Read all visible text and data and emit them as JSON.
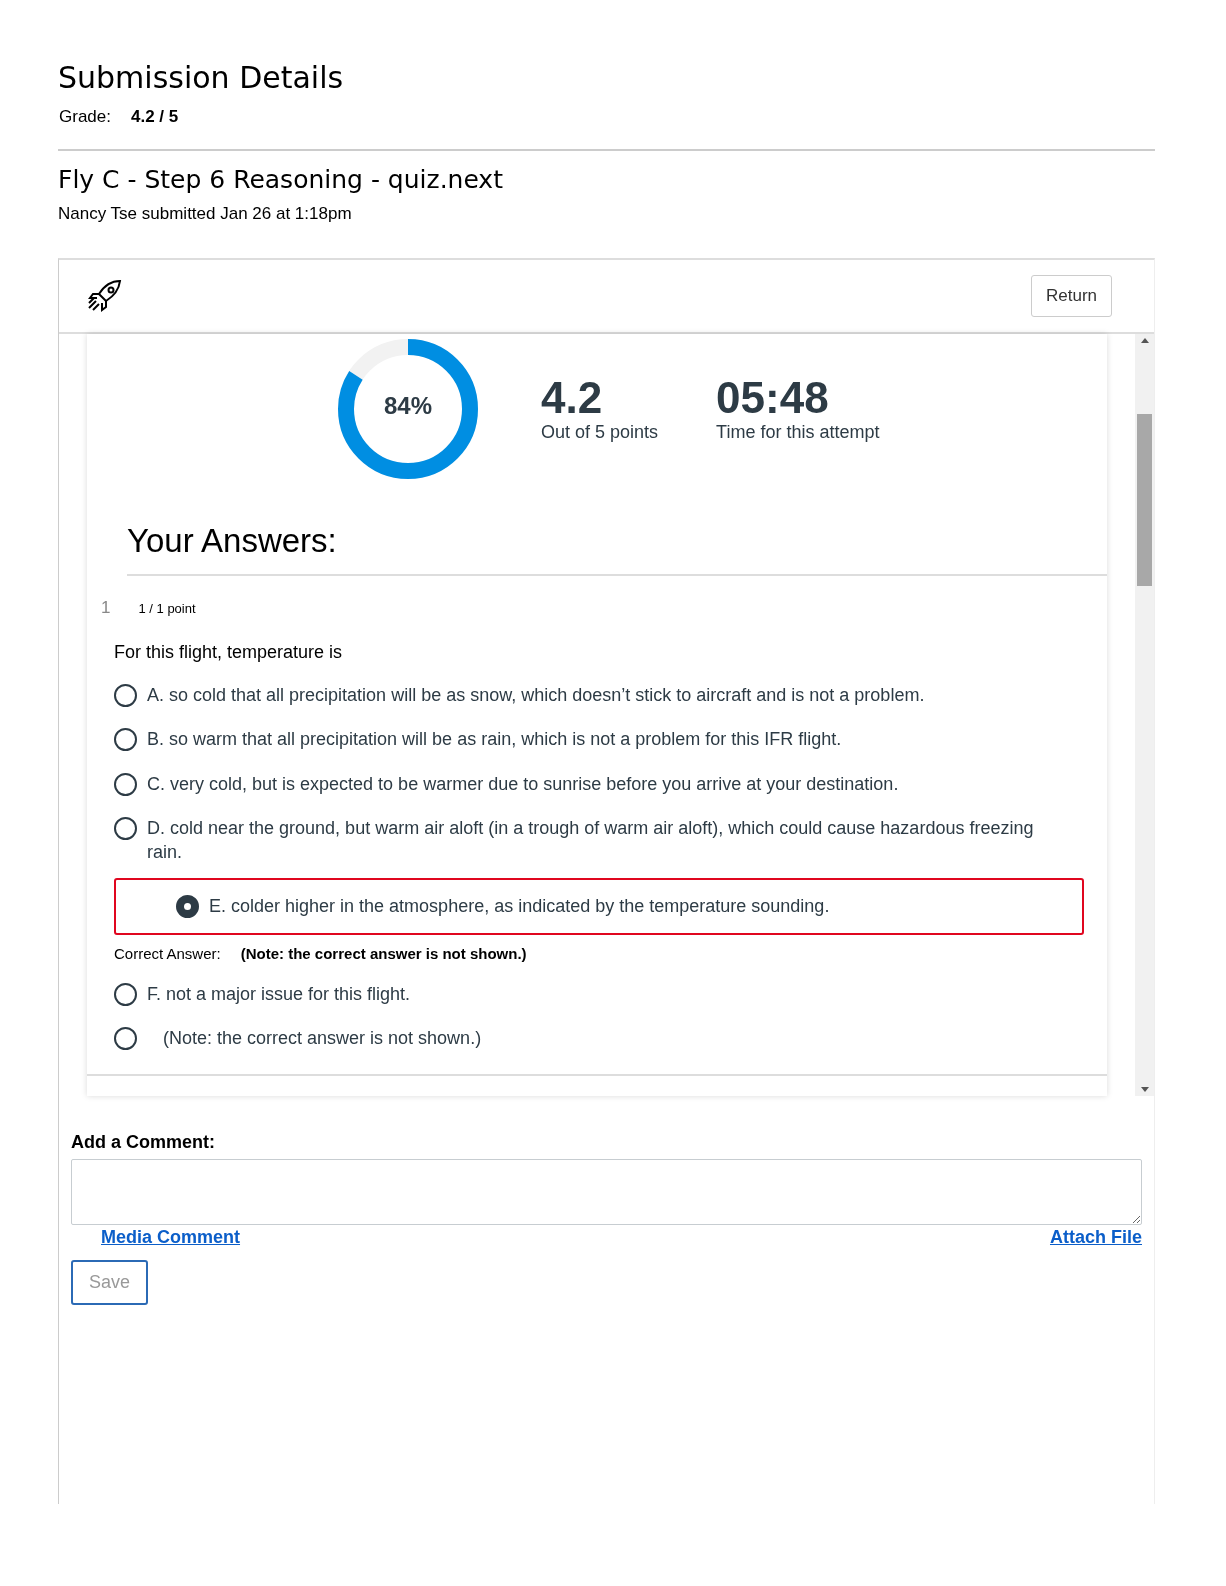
{
  "page_title": "Submission Details",
  "grade": {
    "label": "Grade:",
    "value": "4.2 / 5"
  },
  "assignment": {
    "title": "Fly C - Step 6 Reasoning - quiz.next",
    "submitted": "Nancy Tse submitted Jan 26 at 1:18pm"
  },
  "quiz": {
    "return_button": "Return",
    "score": {
      "percent": "84%"
    },
    "points": {
      "value": "4.2",
      "label": "Out of 5 points"
    },
    "time": {
      "value": "05:48",
      "label": "Time for this attempt"
    },
    "answers_heading": "Your Answers:",
    "questions": [
      {
        "number": "1",
        "points": "1 / 1 point",
        "prompt": "For this flight, temperature is",
        "options": [
          {
            "kind": "option",
            "text": "A. so cold that all precipitation will be as snow, which doesn’t stick to aircraft and is not a problem.",
            "selected": false
          },
          {
            "kind": "option",
            "text": "B. so warm that all precipitation will be as rain, which is not a problem for this IFR flight.",
            "selected": false
          },
          {
            "kind": "option",
            "text": "C. very cold, but is expected to be warmer due to sunrise before you arrive at your destination.",
            "selected": false
          },
          {
            "kind": "option",
            "text": "D. cold near the ground, but warm air aloft (in a trough of warm air aloft), which could cause hazardous freezing rain.",
            "selected": false
          },
          {
            "kind": "option",
            "text": "E. colder higher in the atmosphere, as indicated by the temperature sounding.",
            "selected": true
          },
          {
            "kind": "correct-answer",
            "label": "Correct Answer:",
            "text": "(Note: the correct answer is not shown.)"
          },
          {
            "kind": "option",
            "text": "F. not a major issue for this flight.",
            "selected": false
          },
          {
            "kind": "note",
            "text": "(Note: the correct answer is not shown.)",
            "selected": false
          }
        ]
      }
    ]
  },
  "comment": {
    "label": "Add a Comment:",
    "media_link": "Media Comment",
    "attach_link": "Attach File",
    "save_button": "Save"
  }
}
